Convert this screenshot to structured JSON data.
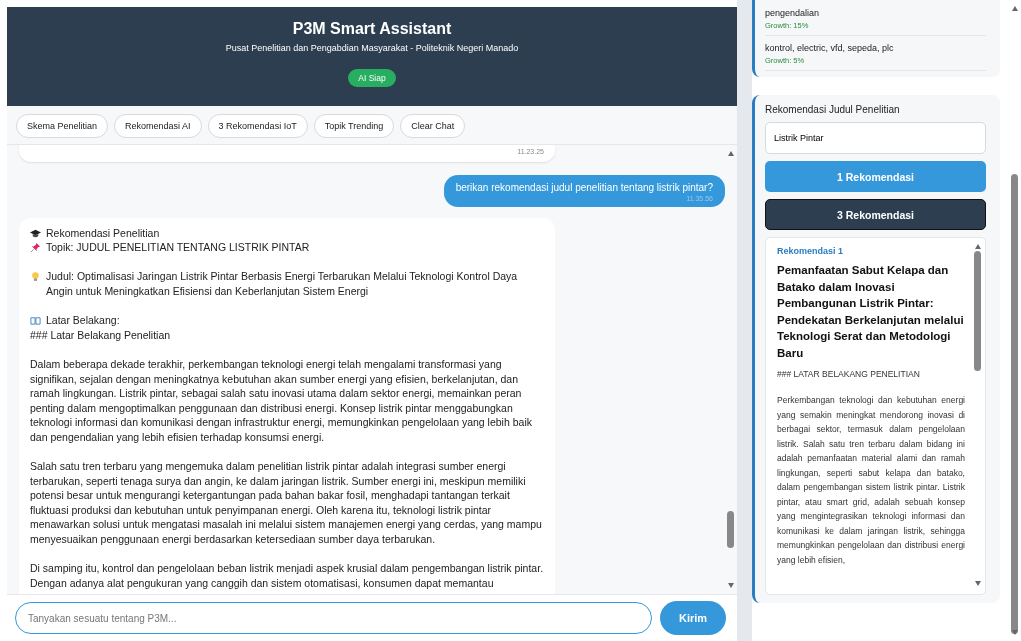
{
  "header": {
    "title": "P3M Smart Assistant",
    "subtitle": "Pusat Penelitian dan Pengabdian Masyarakat - Politeknik Negeri Manado",
    "status": "AI Siap"
  },
  "quick_actions": [
    "Skema Penelitian",
    "Rekomendasi AI",
    "3 Rekomendasi IoT",
    "Topik Trending",
    "Clear Chat"
  ],
  "messages": [
    {
      "kind": "bot",
      "time": "11.23.25"
    },
    {
      "kind": "user",
      "text": "berikan rekomendasi judul penelitian tentang listrik pintar?",
      "time": "11.35.56"
    },
    {
      "kind": "bot",
      "groups": [
        [
          {
            "kind": "heading",
            "text": "Rekomendasi Penelitian"
          },
          {
            "kind": "topic",
            "text": "Topik: JUDUL PENELITIAN TENTANG LISTRIK PINTAR"
          }
        ],
        [
          {
            "kind": "idea",
            "text": "Judul: Optimalisasi Jaringan Listrik Pintar Berbasis Energi Terbarukan Melalui Teknologi Kontrol Daya Angin untuk Meningkatkan Efisiensi dan Keberlanjutan Sistem Energi"
          }
        ],
        [
          {
            "kind": "section",
            "text": "Latar Belakang:"
          },
          {
            "text": "### Latar Belakang Penelitian"
          }
        ],
        [
          {
            "text": "Dalam beberapa dekade terakhir, perkembangan teknologi energi telah mengalami transformasi yang signifikan, sejalan dengan meningkatnya kebutuhan akan sumber energi yang efisien, berkelanjutan, dan ramah lingkungan. Listrik pintar, sebagai salah satu inovasi utama dalam sektor energi, memainkan peran penting dalam mengoptimalkan penggunaan dan distribusi energi. Konsep listrik pintar menggabungkan teknologi informasi dan komunikasi dengan infrastruktur energi, memungkinkan pengelolaan yang lebih baik dan pengendalian yang lebih efisien terhadap konsumsi energi."
          }
        ],
        [
          {
            "text": "Salah satu tren terbaru yang mengemuka dalam penelitian listrik pintar adalah integrasi sumber energi terbarukan, seperti tenaga surya dan angin, ke dalam jaringan listrik. Sumber energi ini, meskipun memiliki potensi besar untuk mengurangi ketergantungan pada bahan bakar fosil, menghadapi tantangan terkait fluktuasi produksi dan kebutuhan untuk penyimpanan energi. Oleh karena itu, teknologi listrik pintar menawarkan solusi untuk mengatasi masalah ini melalui sistem manajemen energi yang cerdas, yang mampu menyesuaikan penggunaan energi berdasarkan ketersediaan sumber daya terbarukan."
          }
        ],
        [
          {
            "text": "Di samping itu, kontrol dan pengelolaan beban listrik menjadi aspek krusial dalam pengembangan listrik pintar. Dengan adanya alat pengukuran yang canggih dan sistem otomatisasi, konsumen dapat memantau"
          }
        ]
      ]
    }
  ],
  "input": {
    "placeholder": "Tanyakan sesuatu tentang P3M..."
  },
  "send_button": "Kirim",
  "trending": [
    {
      "text": "pengendalian",
      "growth": "Growth: 15%"
    },
    {
      "text": "kontrol, electric, vfd, sepeda, plc",
      "growth": "Growth: 5%"
    }
  ],
  "recommend": {
    "title": "Rekomendasi Judul Penelitian",
    "value": "Listrik Pintar",
    "buttons": [
      {
        "label": "1 Rekomendasi",
        "kind": "primary"
      },
      {
        "label": "3 Rekomendasi",
        "kind": "dark"
      }
    ],
    "result": {
      "label": "Rekomendasi 1",
      "title": "Pemanfaatan Sabut Kelapa dan Batako dalam Inovasi Pembangunan Listrik Pintar: Pendekatan Berkelanjutan melalui Teknologi Serat dan Metodologi Baru",
      "section": "### LATAR BELAKANG PENELITIAN",
      "body": "Perkembangan teknologi dan kebutuhan energi yang semakin meningkat mendorong inovasi di berbagai sektor, termasuk dalam pengelolaan listrik. Salah satu tren terbaru dalam bidang ini adalah pemanfaatan material alami dan ramah lingkungan, seperti sabut kelapa dan batako, dalam pengembangan sistem listrik pintar. Listrik pintar, atau smart grid, adalah sebuah konsep yang mengintegrasikan teknologi informasi dan komunikasi ke dalam jaringan listrik, sehingga memungkinkan pengelolaan dan distribusi energi yang lebih efisien,"
    }
  }
}
